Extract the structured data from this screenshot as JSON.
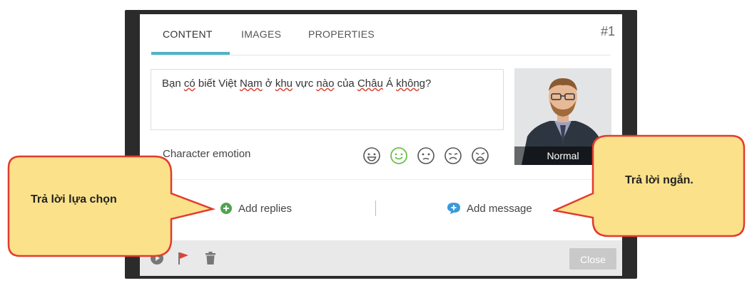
{
  "tabs": [
    {
      "label": "CONTENT"
    },
    {
      "label": "IMAGES"
    },
    {
      "label": "PROPERTIES"
    }
  ],
  "card_number": "#1",
  "content": {
    "text_parts": [
      "Bạn ",
      "có",
      " biết Việt ",
      "Nam",
      " ở ",
      "khu",
      " vực ",
      "nào",
      " của ",
      "Châu",
      " Á ",
      "không",
      "?"
    ]
  },
  "character": {
    "emotion_label": "Character emotion",
    "emotions": [
      "happy",
      "smile",
      "neutral",
      "sad",
      "angry"
    ],
    "selected_emotion": "smile",
    "portrait_label": "Normal"
  },
  "actions": {
    "add_replies": "Add replies",
    "add_message": "Add message"
  },
  "footer": {
    "close_label": "Close"
  },
  "callouts": {
    "left": "Trả lời lựa chọn",
    "right": "Trả lời ngắn."
  },
  "colors": {
    "accent": "#4fb3c9",
    "callout_fill": "#fbe18a",
    "callout_border": "#e23b2e",
    "add_replies_icon": "#4fa44f",
    "add_message_icon": "#3a9ad9",
    "selected_emotion": "#6cbf4c"
  }
}
